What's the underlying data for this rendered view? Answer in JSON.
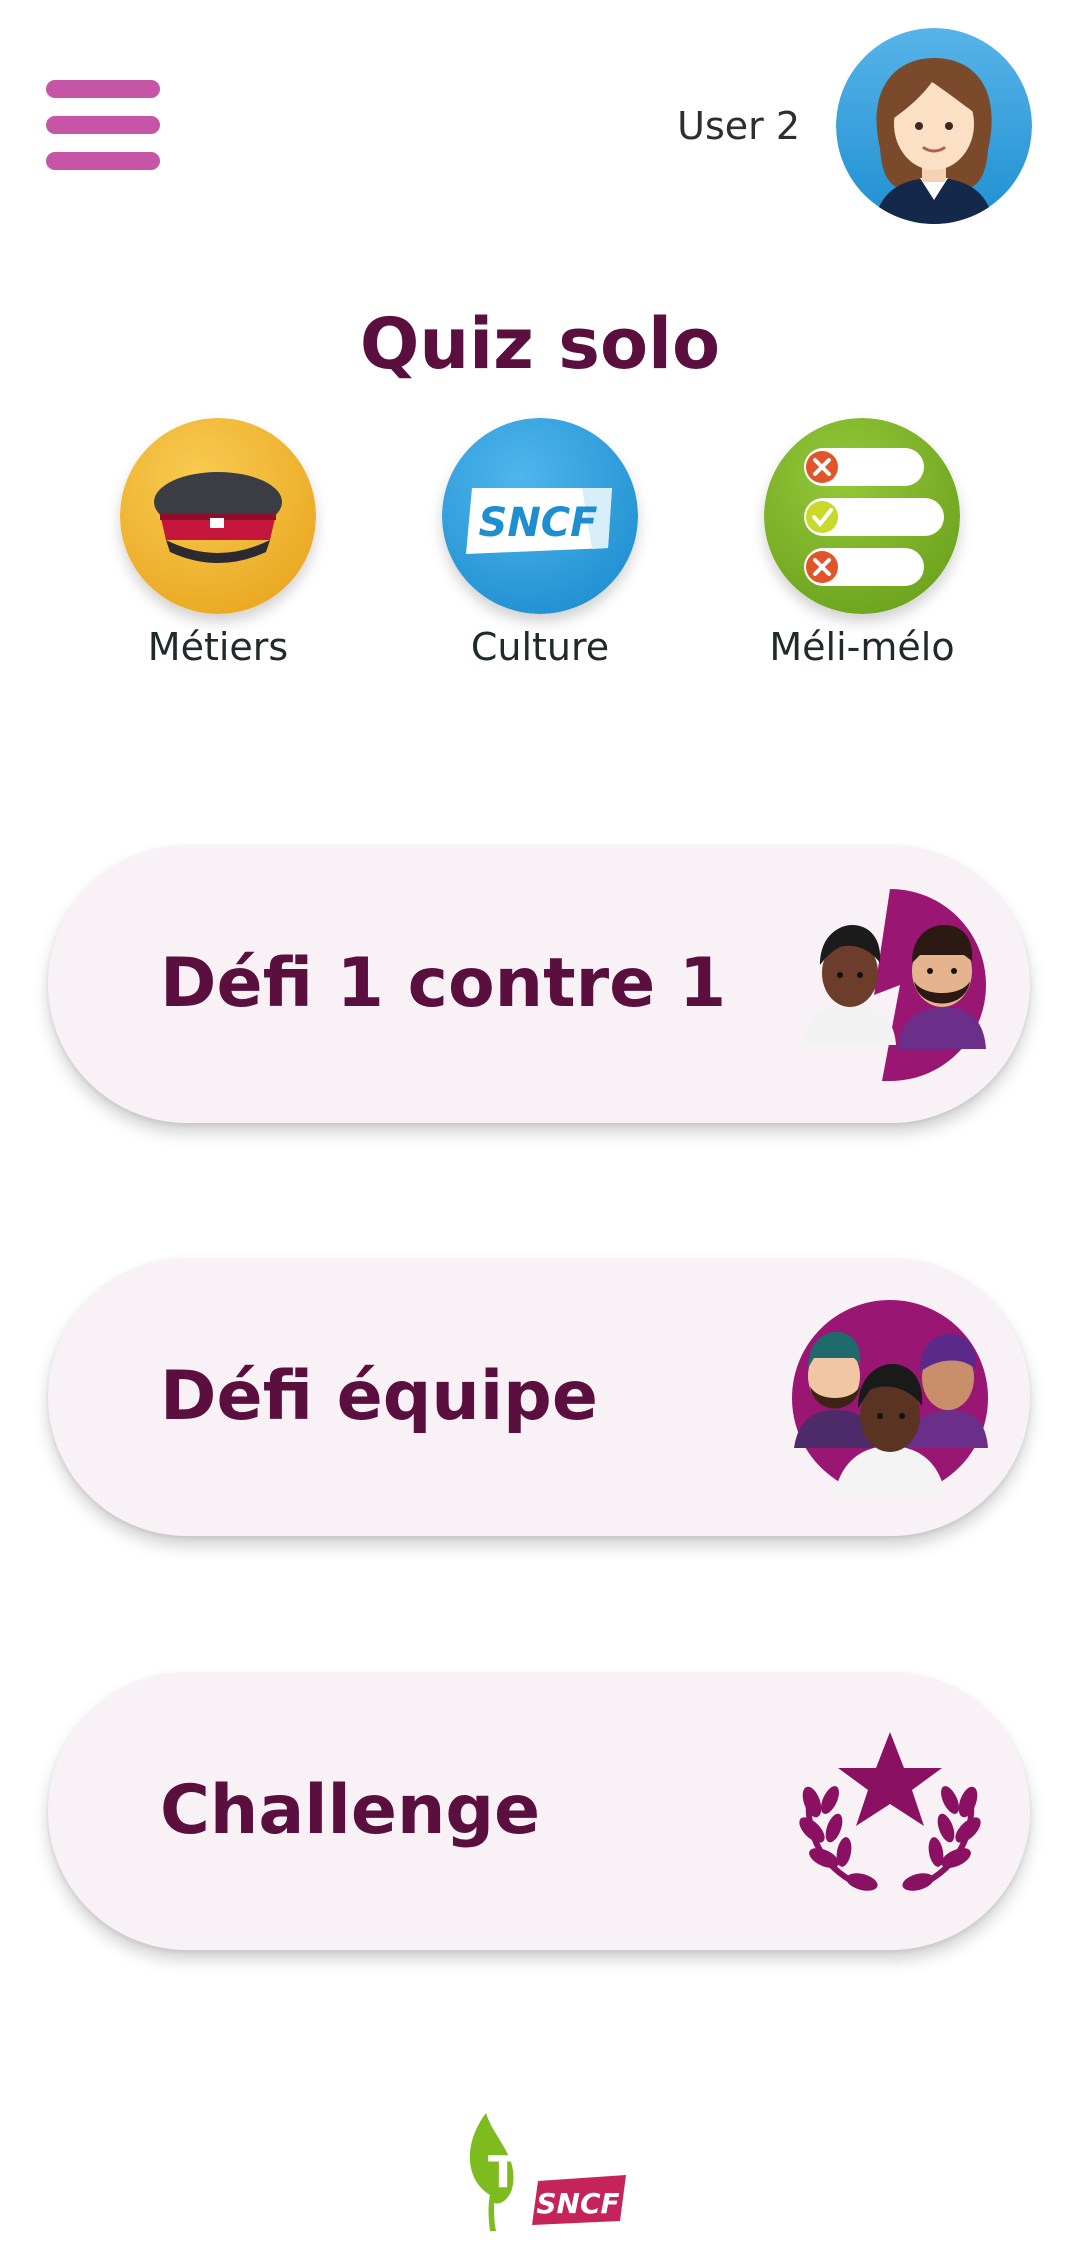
{
  "header": {
    "username": "User 2"
  },
  "quiz_solo": {
    "title": "Quiz solo",
    "categories": [
      {
        "label": "Métiers",
        "icon": "cap-icon",
        "color": "#f2b535"
      },
      {
        "label": "Culture",
        "icon": "sncf-logo-icon",
        "color": "#2fa0dc"
      },
      {
        "label": "Méli-mélo",
        "icon": "checklist-icon",
        "color": "#7db22a"
      }
    ]
  },
  "modes": [
    {
      "label": "Défi 1 contre 1",
      "icon": "versus-avatars-icon"
    },
    {
      "label": "Défi équipe",
      "icon": "team-avatars-icon"
    },
    {
      "label": "Challenge",
      "icon": "laurel-star-icon"
    }
  ],
  "colors": {
    "accent": "#c755a6",
    "title": "#5a0f3e",
    "pill_bg": "#f8f2f6"
  },
  "footer": {
    "logo_text": "SNCF"
  }
}
